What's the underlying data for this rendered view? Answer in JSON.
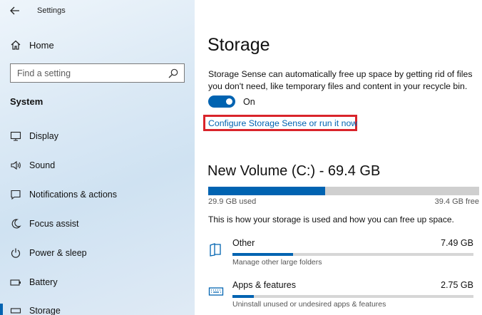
{
  "app": {
    "title": "Settings"
  },
  "sidebar": {
    "home_label": "Home",
    "search_placeholder": "Find a setting",
    "section_title": "System",
    "items": [
      {
        "label": "Display",
        "icon": "display-icon"
      },
      {
        "label": "Sound",
        "icon": "sound-icon"
      },
      {
        "label": "Notifications & actions",
        "icon": "notifications-icon"
      },
      {
        "label": "Focus assist",
        "icon": "focus-assist-icon"
      },
      {
        "label": "Power & sleep",
        "icon": "power-icon"
      },
      {
        "label": "Battery",
        "icon": "battery-icon"
      },
      {
        "label": "Storage",
        "icon": "storage-icon",
        "selected": true
      }
    ]
  },
  "main": {
    "title": "Storage",
    "description": "Storage Sense can automatically free up space by getting rid of files you don't need, like temporary files and content in your recycle bin.",
    "toggle": {
      "state": "On",
      "on": true
    },
    "configure_link": "Configure Storage Sense or run it now",
    "volume": {
      "title": "New Volume (C:) - 69.4 GB",
      "used_label": "29.9 GB used",
      "free_label": "39.4 GB free",
      "used_fraction": 0.431
    },
    "howto": "This is how your storage is used and how you can free up space.",
    "categories": [
      {
        "name": "Other",
        "size": "7.49 GB",
        "subtitle": "Manage other large folders",
        "fraction": 0.25,
        "icon": "folder-icon"
      },
      {
        "name": "Apps & features",
        "size": "2.75 GB",
        "subtitle": "Uninstall unused or undesired apps & features",
        "fraction": 0.09,
        "icon": "keyboard-icon"
      }
    ]
  },
  "colors": {
    "accent": "#0063b1",
    "highlight": "#d9242b"
  }
}
